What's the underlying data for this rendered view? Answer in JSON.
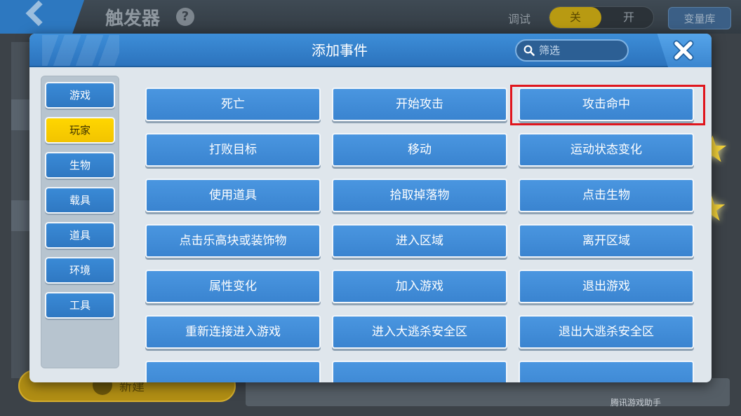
{
  "background": {
    "title": "触发器",
    "help_icon": "question-icon",
    "help_glyph": "?",
    "debug_label": "调试",
    "toggle_off": "关",
    "toggle_on": "开",
    "variable_library": "变量库",
    "new_button_label": "新建",
    "watermark": "腾讯游戏助手",
    "colors": {
      "accent": "#2f78c2",
      "active": "#f2c400",
      "highlight": "#e0161d"
    }
  },
  "modal": {
    "title": "添加事件",
    "search": {
      "placeholder": "筛选",
      "value": "",
      "icon": "search-icon"
    },
    "close_icon": "close-icon"
  },
  "sidebar": {
    "items": [
      {
        "label": "游戏",
        "active": false
      },
      {
        "label": "玩家",
        "active": true
      },
      {
        "label": "生物",
        "active": false
      },
      {
        "label": "载具",
        "active": false
      },
      {
        "label": "道具",
        "active": false
      },
      {
        "label": "环境",
        "active": false
      },
      {
        "label": "工具",
        "active": false
      }
    ]
  },
  "events": [
    {
      "label": "死亡"
    },
    {
      "label": "开始攻击"
    },
    {
      "label": "攻击命中",
      "highlighted": true
    },
    {
      "label": "打败目标"
    },
    {
      "label": "移动"
    },
    {
      "label": "运动状态变化"
    },
    {
      "label": "使用道具"
    },
    {
      "label": "拾取掉落物"
    },
    {
      "label": "点击生物"
    },
    {
      "label": "点击乐高块或装饰物"
    },
    {
      "label": "进入区域"
    },
    {
      "label": "离开区域"
    },
    {
      "label": "属性变化"
    },
    {
      "label": "加入游戏"
    },
    {
      "label": "退出游戏"
    },
    {
      "label": "重新连接进入游戏"
    },
    {
      "label": "进入大逃杀安全区"
    },
    {
      "label": "退出大逃杀安全区"
    },
    {
      "label": ""
    },
    {
      "label": ""
    },
    {
      "label": ""
    }
  ]
}
